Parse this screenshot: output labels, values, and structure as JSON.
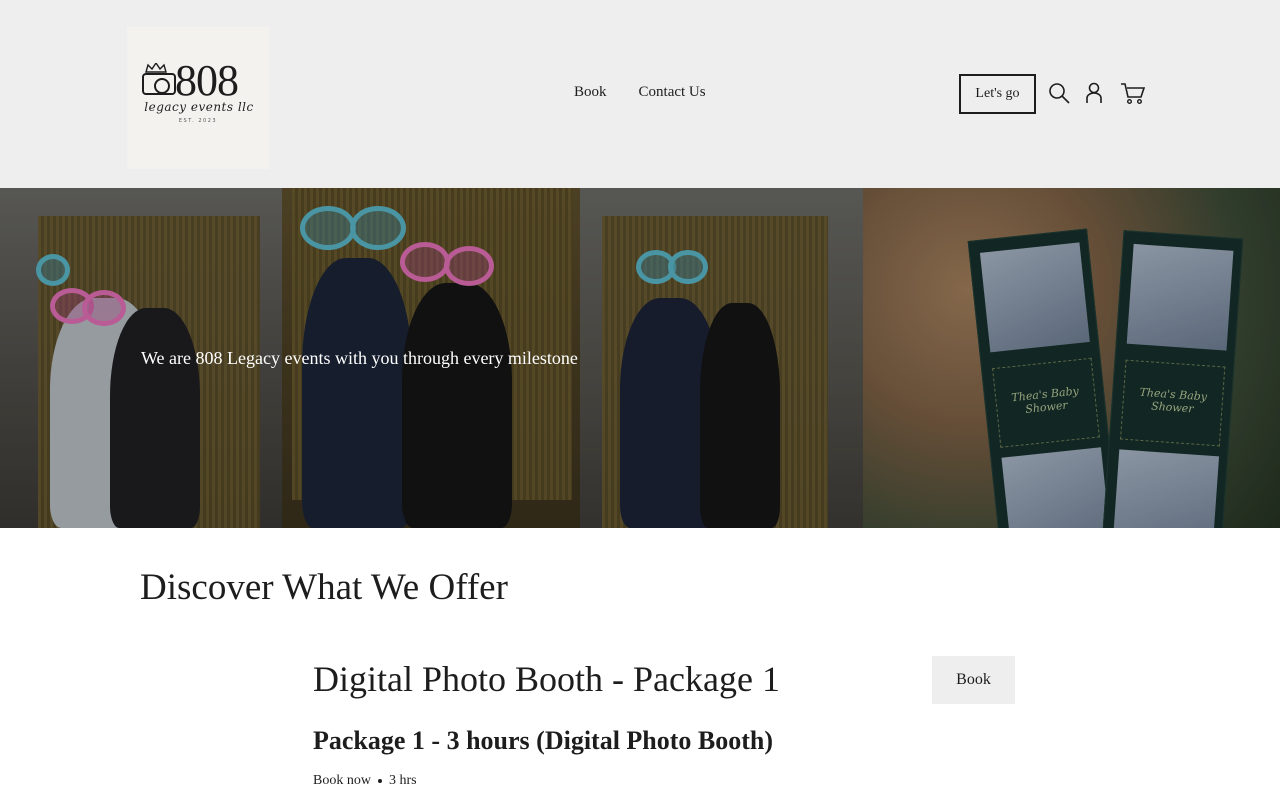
{
  "brand": {
    "logo_number": "808",
    "logo_script": "legacy events llc",
    "logo_est": "EST. 2023"
  },
  "nav": {
    "items": [
      {
        "label": "Book"
      },
      {
        "label": "Contact Us"
      }
    ]
  },
  "header_actions": {
    "cta_label": "Let's go",
    "icons": [
      "search-icon",
      "account-icon",
      "cart-icon"
    ]
  },
  "hero": {
    "tagline": "We are 808 Legacy events with you through every milestone",
    "strip_caption": "Thea's Baby Shower"
  },
  "offers": {
    "section_title": "Discover What We Offer",
    "service": {
      "title": "Digital Photo Booth - Package 1",
      "book_label": "Book",
      "subtitle": "Package 1 - 3 hours (Digital Photo Booth)",
      "meta_book": "Book now",
      "meta_duration": "3 hrs"
    }
  }
}
